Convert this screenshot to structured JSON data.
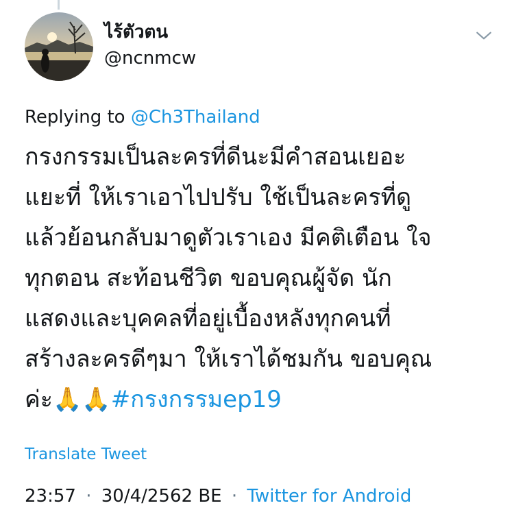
{
  "author": {
    "display_name": "ไร้ตัวตน",
    "handle": "@ncnmcw",
    "avatar_icon": "avatar-silhouette-sunset"
  },
  "more_icon": "chevron-down-icon",
  "reply": {
    "prefix": "Replying to",
    "mention": "@Ch3Thailand"
  },
  "tweet": {
    "lines": [
      "กรงกรรมเป็นละครที่ดีนะมีคำสอนเยอะ",
      "แยะที่ ให้เราเอาไปปรับ ใช้เป็นละครที่ดู",
      "แล้วย้อนกลับมาดูตัวเราเอง มีคติเตือน ใจ",
      "ทุกตอน สะท้อนชีวิต ขอบคุณผู้จัด นัก",
      "แสดงและบุคคลที่อยู่เบื้องหลังทุกคนที่",
      "สร้างละครดีๆมา ให้เราได้ชมกัน ขอบคุณ"
    ],
    "last_line_text": "ค่ะ",
    "emoji": "🙏🙏",
    "hashtag": "#กรงกรรมep19"
  },
  "translate_label": "Translate Tweet",
  "meta": {
    "time": "23:57",
    "separator": "·",
    "date": "30/4/2562 BE",
    "source": "Twitter for Android"
  },
  "colors": {
    "link": "#1b95e0",
    "text": "#14171a",
    "muted": "#657786"
  }
}
